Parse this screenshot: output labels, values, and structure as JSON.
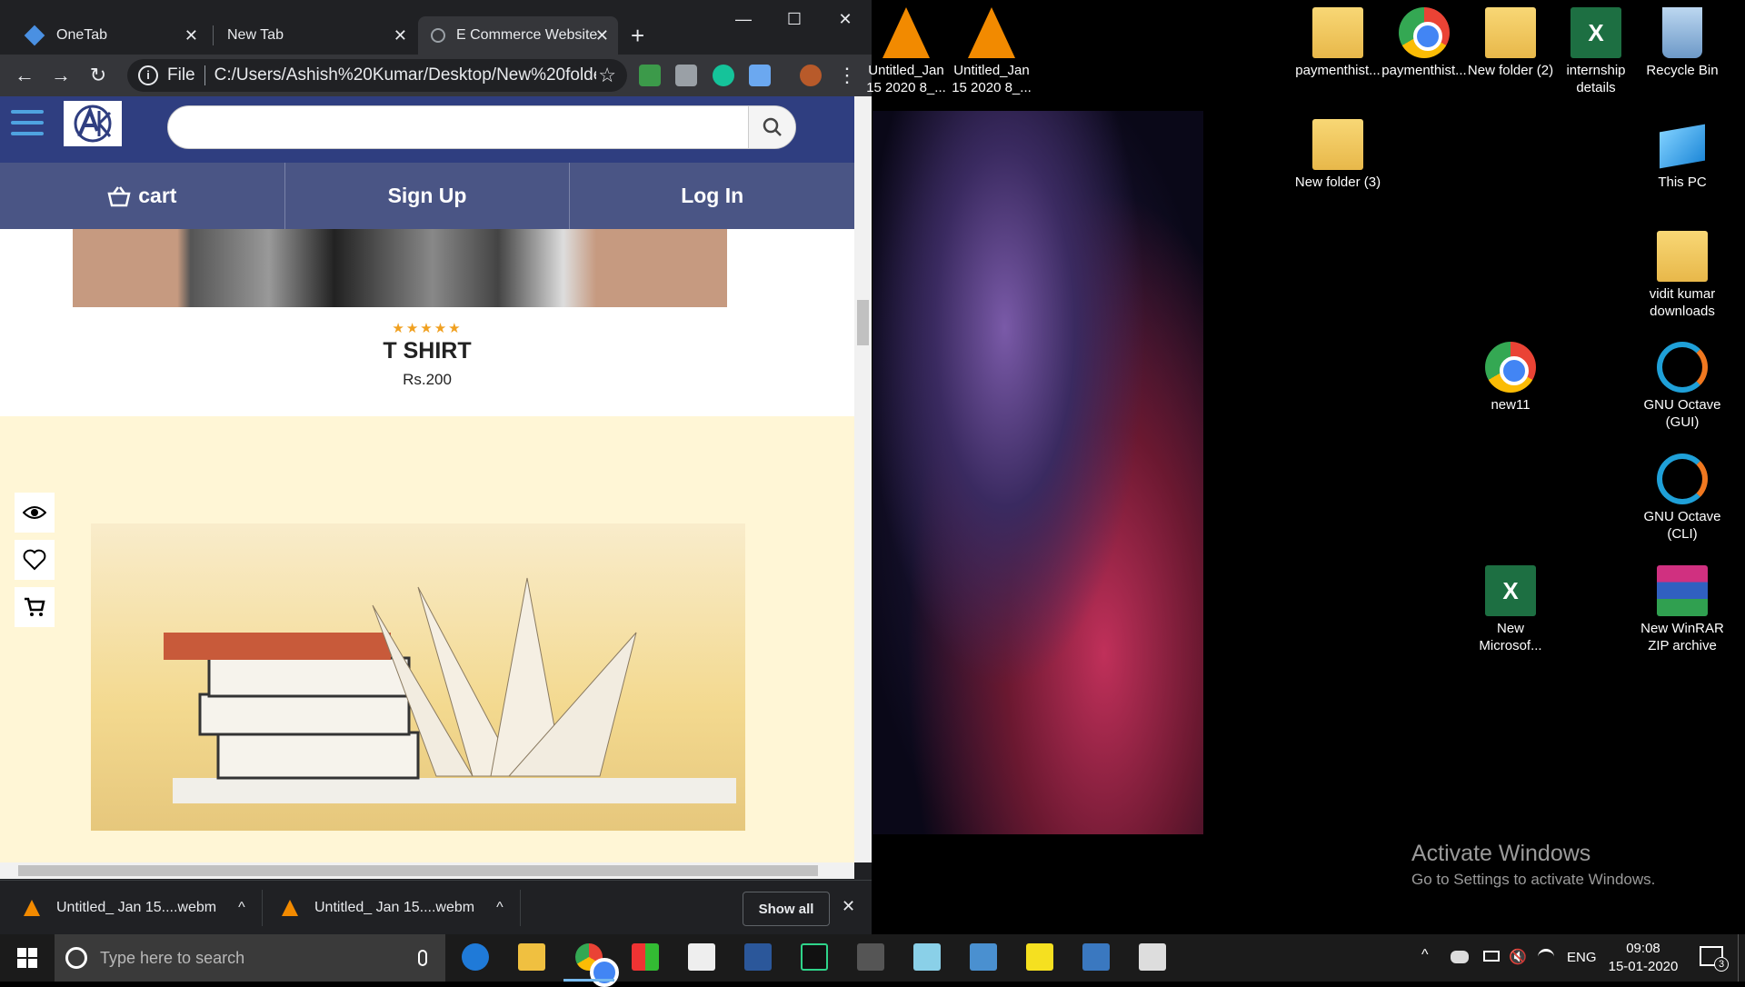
{
  "browser": {
    "tabs": [
      {
        "title": "OneTab",
        "close": "✕"
      },
      {
        "title": "New Tab",
        "close": "✕"
      },
      {
        "title": "E Commerce Website",
        "close": "✕"
      }
    ],
    "new_tab": "+",
    "window_controls": {
      "minimize": "—",
      "maximize": "☐",
      "close": "✕"
    },
    "nav": {
      "back": "←",
      "forward": "→",
      "reload": "↻"
    },
    "omnibox": {
      "info": "i",
      "scheme": "File",
      "url": "C:/Users/Ashish%20Kumar/Desktop/New%20folder...",
      "star": "☆"
    },
    "menu": "⋮"
  },
  "site": {
    "search_placeholder": "",
    "nav": {
      "cart": "cart",
      "signup": "Sign Up",
      "login": "Log In"
    },
    "product": {
      "stars": "★★★★★",
      "name": "T SHIRT",
      "price": "Rs.200"
    }
  },
  "downloads": {
    "items": [
      {
        "name": "Untitled_ Jan 15....webm",
        "caret": "^"
      },
      {
        "name": "Untitled_ Jan 15....webm",
        "caret": "^"
      }
    ],
    "show_all": "Show all",
    "close": "✕"
  },
  "desktop": {
    "icons": [
      {
        "label": "Untitled_Jan 15 2020 8_...",
        "type": "vlc-icon"
      },
      {
        "label": "Untitled_Jan 15 2020 8_...",
        "type": "vlc-icon"
      },
      {
        "label": "paymenthist...",
        "type": "folder-icon"
      },
      {
        "label": "paymenthist...",
        "type": "chrome-icon"
      },
      {
        "label": "New folder (2)",
        "type": "folder-icon"
      },
      {
        "label": "internship details",
        "type": "excel-icon"
      },
      {
        "label": "Recycle Bin",
        "type": "recycle-bin-icon"
      },
      {
        "label": "New folder (3)",
        "type": "folder-icon"
      },
      {
        "label": "This PC",
        "type": "pc-icon"
      },
      {
        "label": "vidit kumar downloads",
        "type": "folder-icon"
      },
      {
        "label": "new11",
        "type": "chrome-icon"
      },
      {
        "label": "GNU Octave (GUI)",
        "type": "octave-icon"
      },
      {
        "label": "GNU Octave (CLI)",
        "type": "octave-icon"
      },
      {
        "label": "New Microsof...",
        "type": "excel-icon"
      },
      {
        "label": "New WinRAR ZIP archive",
        "type": "winrar-icon"
      }
    ],
    "activate": {
      "title": "Activate Windows",
      "subtitle": "Go to Settings to activate Windows."
    }
  },
  "taskbar": {
    "search_placeholder": "Type here to search",
    "lang": "ENG",
    "time": "09:08",
    "date": "15-01-2020",
    "notifications": "3"
  }
}
